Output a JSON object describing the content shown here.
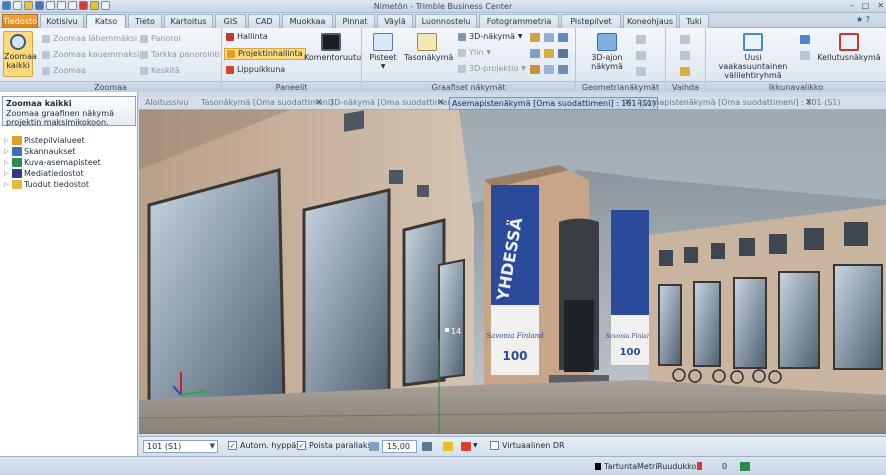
{
  "window": {
    "title": "Nimetön - Trimble Business Center",
    "controls": [
      "–",
      "□",
      "✕"
    ]
  },
  "tabs": [
    {
      "label": "Tiedosto",
      "kind": "file"
    },
    {
      "label": "Kotisivu"
    },
    {
      "label": "Katso",
      "kind": "active"
    },
    {
      "label": "Tieto"
    },
    {
      "label": "Kartoitus"
    },
    {
      "label": "GIS"
    },
    {
      "label": "CAD"
    },
    {
      "label": "Muokkaa"
    },
    {
      "label": "Pinnat"
    },
    {
      "label": "Väylä"
    },
    {
      "label": "Luonnostelu"
    },
    {
      "label": "Fotogrammetria"
    },
    {
      "label": "Pistepilvet"
    },
    {
      "label": "Koneohjaus"
    },
    {
      "label": "Tuki"
    }
  ],
  "ribbon": {
    "zoomaa": {
      "group": "Zoomaa",
      "big": "Zoomaa kaikki",
      "items": [
        "Zoomaa lähemmäksi",
        "Zoomaa kauemmaksi",
        "Zoomaa",
        "Panoroi",
        "Tarkka panorointi",
        "Keskitä"
      ]
    },
    "paneelit": {
      "group": "Paneelit",
      "items": [
        "Hallinta",
        "Projektinhallinta",
        "Lippuikkuna"
      ],
      "big": "Komentoruutu"
    },
    "graafiset": {
      "group": "Graafiset näkymät",
      "big1": "Pisteet",
      "big2": "Tasonäkymä",
      "items": [
        "3D-näkymä",
        "Ylin",
        "3D-projektio"
      ]
    },
    "geom": {
      "group": "Geometrianäkymät",
      "big": "3D-ajon näkymä"
    },
    "vaihda": {
      "group": "Vaihda"
    },
    "ikkuna": {
      "group": "Ikkunavalikko",
      "big1": "Uusi vaakasuuntainen välilehtiryhmä",
      "big2": "Kellutusnäkymä"
    }
  },
  "tooltip": {
    "title": "Zoomaa kaikki",
    "text": "Zoomaa graafinen näkymä projektin maksimikokoon."
  },
  "tree": [
    {
      "label": "Pistepilvialueet",
      "color": "#e0a020"
    },
    {
      "label": "Skannaukset",
      "color": "#3b6fb8"
    },
    {
      "label": "Kuva-asemapisteet",
      "color": "#2c8a4a"
    },
    {
      "label": "Mediatiedostot",
      "color": "#333a8c"
    },
    {
      "label": "Tuodut tiedostot",
      "color": "#e8b840"
    }
  ],
  "doctabs": [
    "Aloitussivu",
    "Tasonäkymä [Oma suodattimeni]",
    "3D-näkymä [Oma suodattimeni]",
    "Asemapistenäkymä [Oma suodattimeni] : 101 (S1)",
    "Asemapistenäkymä [Oma suodattimeni] : 101 (S1)"
  ],
  "view": {
    "banner_left": "YHDESSÄ",
    "banner_sub": "Savonia Finland",
    "banner_num": "100",
    "marker": "14"
  },
  "bottombar": {
    "station": "101 (S1)",
    "chk1": "Autom. hyppäys",
    "chk2": "Poista parallaksi",
    "value": "15,00",
    "chk3": "Virtuaalinen DR"
  },
  "statusbar": {
    "snap": "Tartunta",
    "units": "Metri",
    "grid": "Ruudukko",
    "count": "0"
  }
}
